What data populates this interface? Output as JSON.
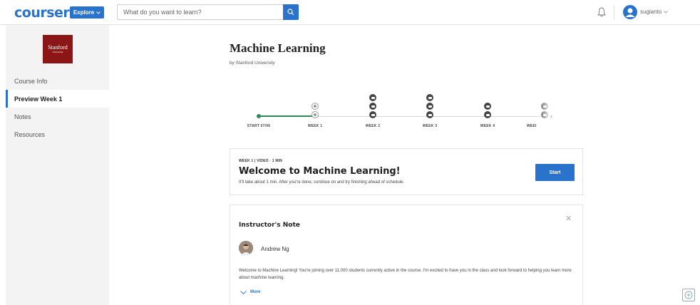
{
  "header": {
    "logo": "coursera",
    "explore_label": "Explore",
    "search_placeholder": "What do you want to learn?",
    "username": "sugianto"
  },
  "sidebar": {
    "university_logo_line1": "Stanford",
    "university_logo_line2": "University",
    "items": [
      {
        "label": "Course Info",
        "active": false
      },
      {
        "label": "Preview Week 1",
        "active": true
      },
      {
        "label": "Notes",
        "active": false
      },
      {
        "label": "Resources",
        "active": false
      }
    ]
  },
  "course": {
    "title": "Machine Learning",
    "byline": "by Stanford University"
  },
  "timeline": {
    "labels": [
      "START 07/06",
      "WEEK 1",
      "WEEK 2",
      "WEEK 3",
      "WEEK 4",
      "WEEI"
    ]
  },
  "welcome_card": {
    "meta": "WEEK 1 | VIDEO · 1 MIN",
    "title": "Welcome to Machine Learning!",
    "description": "It'll take about 1 min. After you're done, continue on and try finishing ahead of schedule.",
    "start_label": "Start"
  },
  "note_card": {
    "title": "Instructor's Note",
    "instructor_name": "Andrew Ng",
    "body": "Welcome to Machine Learning! You're joining over 11,000 students currently active in the course. I'm excited to have you in the class and look forward to helping you learn more about machine learning.",
    "more_label": "More"
  },
  "colors": {
    "brand_blue": "#2a73cc",
    "progress_green": "#2c8c57",
    "stanford_red": "#8c1515"
  },
  "icons": [
    "search-icon",
    "bell-icon",
    "user-avatar-icon",
    "chevron-down-icon",
    "close-icon",
    "video-icon",
    "help-icon"
  ]
}
